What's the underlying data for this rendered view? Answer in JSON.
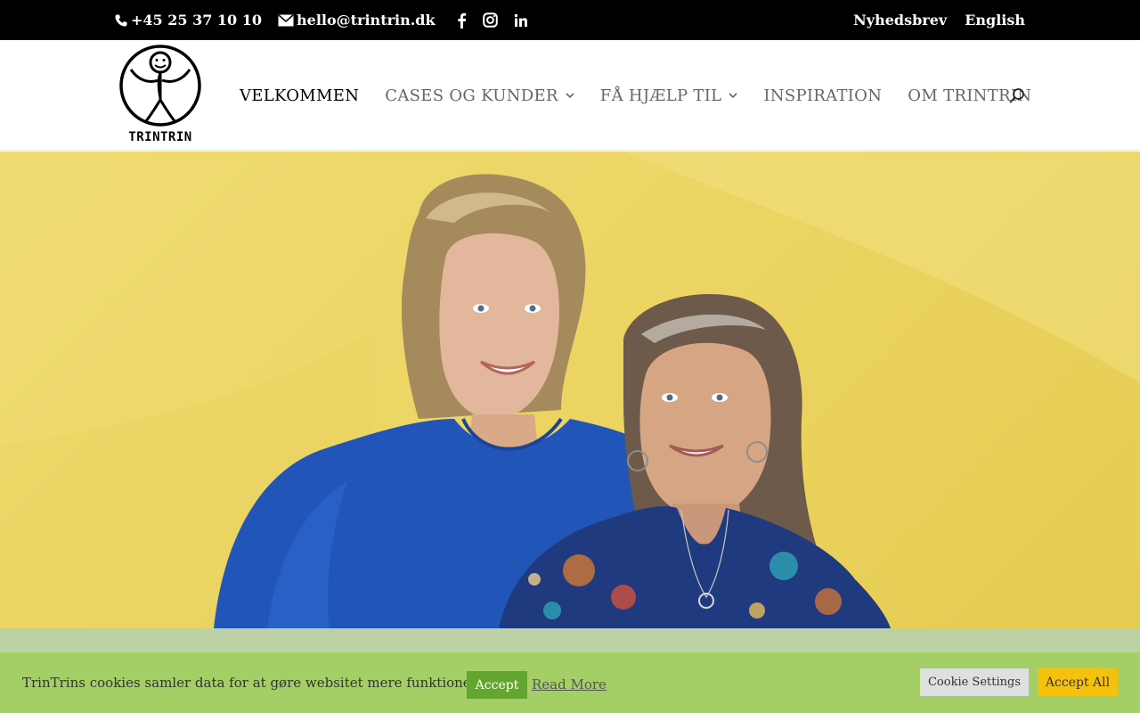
{
  "topbar": {
    "phone": "+45 25 37 10 10",
    "email": "hello@trintrin.dk",
    "social": [
      "facebook-icon",
      "instagram-icon",
      "linkedin-icon"
    ],
    "newsletter": "Nyhedsbrev",
    "language": "English"
  },
  "header": {
    "logo_text": "TRINTRIN",
    "nav": [
      {
        "label": "VELKOMMEN",
        "active": true,
        "has_submenu": false
      },
      {
        "label": "CASES OG KUNDER",
        "active": false,
        "has_submenu": true
      },
      {
        "label": "FÅ HJÆLP TIL",
        "active": false,
        "has_submenu": true
      },
      {
        "label": "INSPIRATION",
        "active": false,
        "has_submenu": false
      },
      {
        "label": "OM TRINTRIN",
        "active": false,
        "has_submenu": false
      }
    ],
    "search_icon": "search-icon"
  },
  "hero": {
    "image": "two-smiling-women-on-yellow-background"
  },
  "cookie": {
    "message": "TrinTrins cookies samler data for at gøre websitet mere funktionelt.",
    "accept": "Accept",
    "read_more": "Read More",
    "settings": "Cookie Settings",
    "accept_all": "Accept All"
  },
  "colors": {
    "topbar_bg": "#000000",
    "hero_bg": "#ecd564",
    "cookie_bg": "#a4cf66",
    "accept_btn": "#63a62f",
    "accept_all_btn": "#f4c20d",
    "settings_btn": "#dedfe0",
    "nav_active": "#000000",
    "nav_inactive": "#666666"
  }
}
